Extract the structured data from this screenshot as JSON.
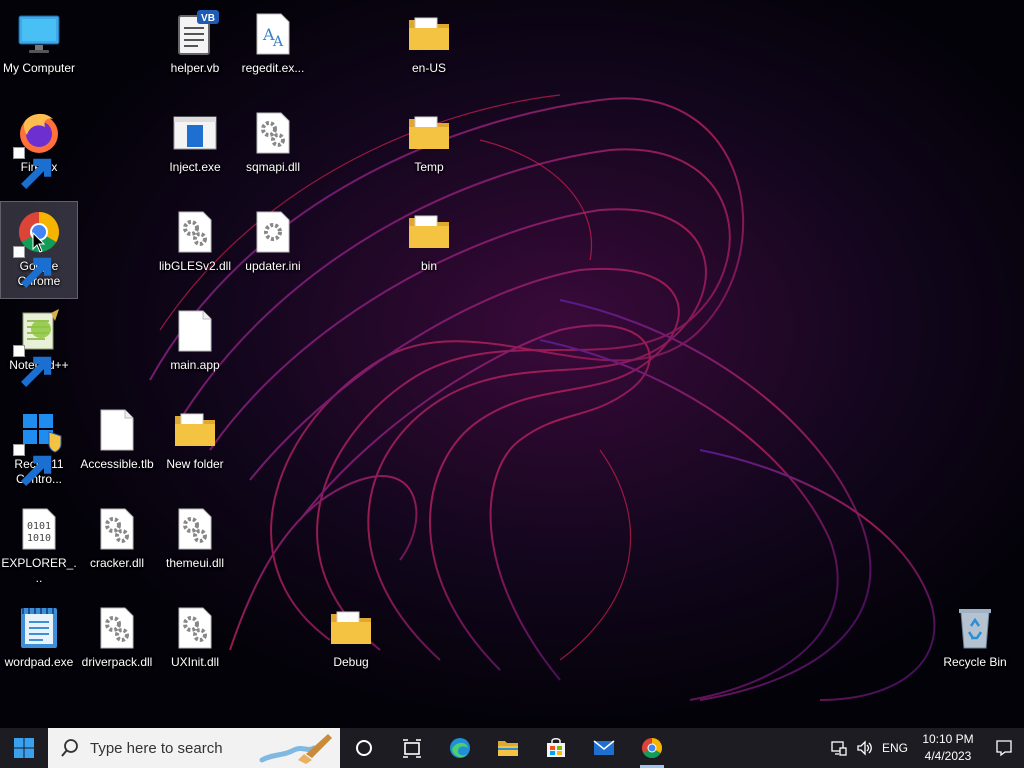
{
  "desktop": {
    "icons": {
      "my_computer": "My Computer",
      "firefox": "Firefox",
      "chrome": "Google Chrome",
      "notepadpp": "Notepad++",
      "rectify": "Rectify11 Contro...",
      "explorer": "EXPLORER_...",
      "wordpad": "wordpad.exe",
      "helper": "helper.vb",
      "inject": "Inject.exe",
      "libgles": "libGLESv2.dll",
      "mainapp": "main.app",
      "accessible": "Accessible.tlb",
      "newfolder": "New folder",
      "cracker": "cracker.dll",
      "themeui": "themeui.dll",
      "driverpack": "driverpack.dll",
      "uxinit": "UXInit.dll",
      "regedit": "regedit.ex...",
      "sqmapi": "sqmapi.dll",
      "updater": "updater.ini",
      "debug": "Debug",
      "enus": "en-US",
      "temp": "Temp",
      "bin": "bin",
      "recycle": "Recycle Bin"
    },
    "vb_badge": "VB",
    "bin_code_top": "0101",
    "bin_code_bottom": "1010",
    "selected_icon": "chrome"
  },
  "taskbar": {
    "search_placeholder": "Type here to search",
    "language": "ENG",
    "time": "10:10 PM",
    "date": "4/4/2023",
    "active_app": "chrome"
  },
  "colors": {
    "accent": "#0078d4",
    "folder": "#f5c342",
    "taskbar": "#1c1c22"
  }
}
